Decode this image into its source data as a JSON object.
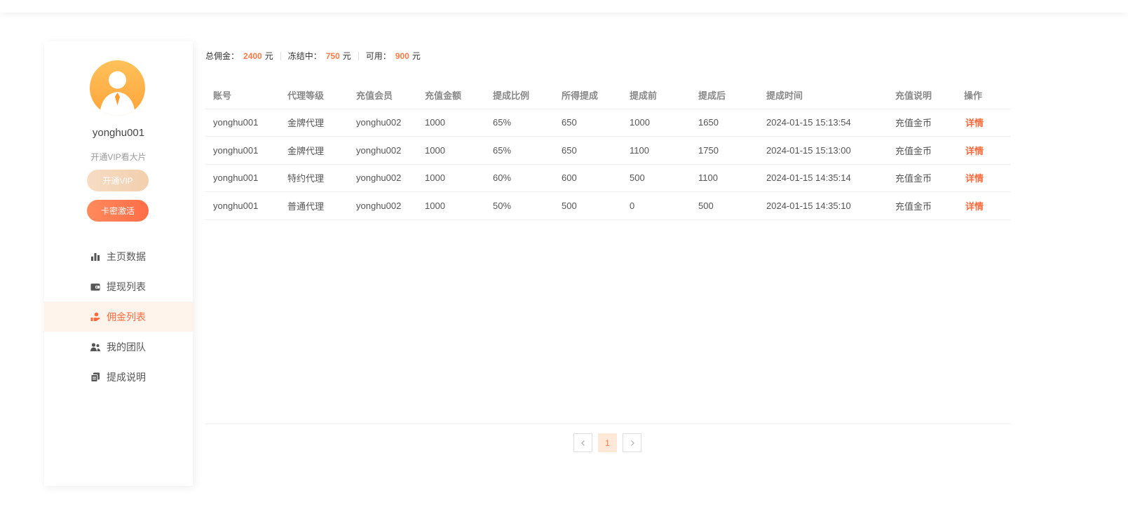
{
  "profile": {
    "username": "yonghu001",
    "vip_tip": "开通VIP看大片",
    "vip_button": "开通VIP",
    "card_button": "卡密激活"
  },
  "nav": {
    "items": [
      {
        "label": "主页数据",
        "icon": "bar-chart-icon",
        "active": false
      },
      {
        "label": "提现列表",
        "icon": "wallet-icon",
        "active": false
      },
      {
        "label": "佣金列表",
        "icon": "hand-coin-icon",
        "active": true
      },
      {
        "label": "我的团队",
        "icon": "team-icon",
        "active": false
      },
      {
        "label": "提成说明",
        "icon": "document-icon",
        "active": false
      }
    ]
  },
  "summary": {
    "total_label": "总佣金：",
    "total_value": "2400",
    "frozen_label": "冻结中：",
    "frozen_value": "750",
    "available_label": "可用：",
    "available_value": "900",
    "unit": "元"
  },
  "table": {
    "headers": [
      "账号",
      "代理等级",
      "充值会员",
      "充值金额",
      "提成比例",
      "所得提成",
      "提成前",
      "提成后",
      "提成时间",
      "充值说明",
      "操作"
    ],
    "rows": [
      [
        "yonghu001",
        "金牌代理",
        "yonghu002",
        "1000",
        "65%",
        "650",
        "1000",
        "1650",
        "2024-01-15 15:13:54",
        "充值金币",
        "详情"
      ],
      [
        "yonghu001",
        "金牌代理",
        "yonghu002",
        "1000",
        "65%",
        "650",
        "1100",
        "1750",
        "2024-01-15 15:13:00",
        "充值金币",
        "详情"
      ],
      [
        "yonghu001",
        "特约代理",
        "yonghu002",
        "1000",
        "60%",
        "600",
        "500",
        "1100",
        "2024-01-15 14:35:14",
        "充值金币",
        "详情"
      ],
      [
        "yonghu001",
        "普通代理",
        "yonghu002",
        "1000",
        "50%",
        "500",
        "0",
        "500",
        "2024-01-15 14:35:10",
        "充值金币",
        "详情"
      ]
    ]
  },
  "pagination": {
    "current": "1"
  },
  "colors": {
    "accent": "#ff6a3c",
    "avatar": "#ffab40",
    "active_bg": "#fff4ec"
  }
}
